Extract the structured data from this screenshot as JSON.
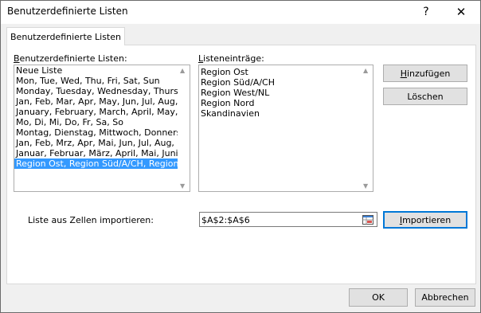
{
  "window": {
    "title": "Benutzerdefinierte Listen",
    "help": "?",
    "close": "✕"
  },
  "tabs": [
    {
      "label": "Benutzerdefinierte Listen"
    }
  ],
  "custom_lists": {
    "label": "Benutzerdefinierte Listen:",
    "items": [
      "Neue Liste",
      "Mon, Tue, Wed, Thu, Fri, Sat, Sun",
      "Monday, Tuesday, Wednesday, Thursday",
      "Jan, Feb, Mar, Apr, May, Jun, Jul, Aug, S",
      "January, February, March, April, May, Ju",
      "Mo, Di, Mi, Do, Fr, Sa, So",
      "Montag, Dienstag, Mittwoch, Donnerst",
      "Jan, Feb, Mrz, Apr, Mai, Jun, Jul, Aug, S",
      "Januar, Februar, März, April, Mai, Juni, .",
      "Region Ost, Region Süd/A/CH, Region"
    ],
    "selected_index": 9
  },
  "list_entries": {
    "label": "Listeneinträge:",
    "items": [
      "Region Ost",
      "Region Süd/A/CH",
      "Region West/NL",
      "Region Nord",
      "Skandinavien"
    ]
  },
  "buttons": {
    "add": "Hinzufügen",
    "delete": "Löschen",
    "import": "Importieren",
    "ok": "OK",
    "cancel": "Abbrechen"
  },
  "import": {
    "label": "Liste aus Zellen importieren:",
    "value": "$A$2:$A$6"
  },
  "colors": {
    "selection": "#3399ff",
    "default_button_border": "#0078d7"
  }
}
